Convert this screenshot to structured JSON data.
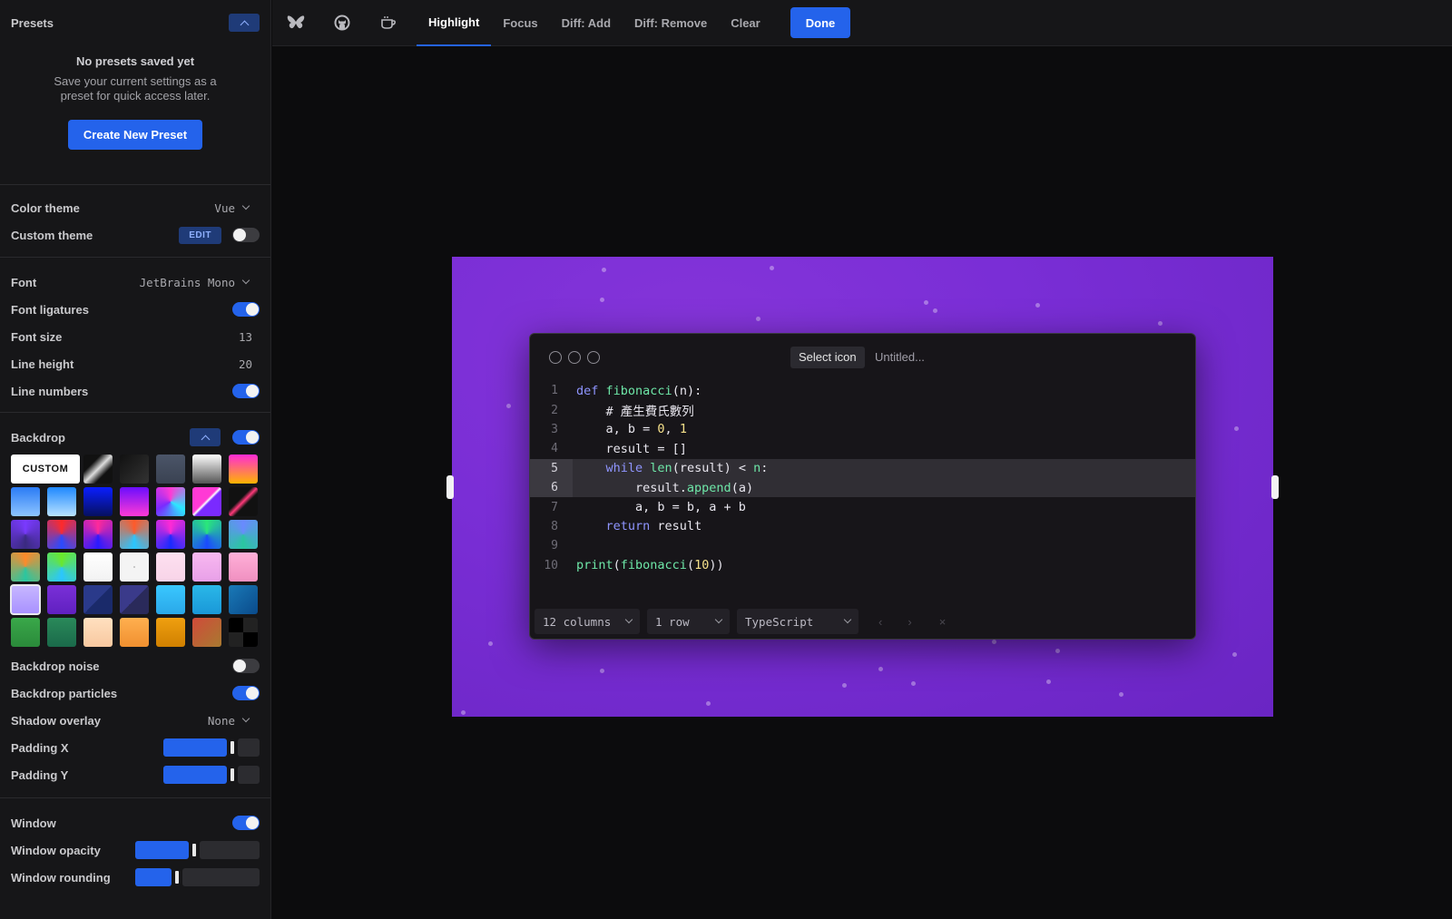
{
  "presets": {
    "title": "Presets",
    "empty_title": "No presets saved yet",
    "empty_desc": "Save your current settings as a preset for quick access later.",
    "create_label": "Create New Preset"
  },
  "theme": {
    "color_theme_label": "Color theme",
    "color_theme_value": "Vue",
    "custom_theme_label": "Custom theme",
    "edit_label": "EDIT",
    "custom_theme_on": false
  },
  "font": {
    "font_label": "Font",
    "font_value": "JetBrains Mono",
    "ligatures_label": "Font ligatures",
    "size_label": "Font size",
    "size_value": "13",
    "line_height_label": "Line height",
    "line_height_value": "20",
    "line_numbers_label": "Line numbers"
  },
  "backdrop": {
    "label": "Backdrop",
    "custom_label": "CUSTOM",
    "swatches": [
      "linear-gradient(135deg,#111 30%,#ddd 50%,#111 70%)",
      "linear-gradient(135deg,#111,#333)",
      "linear-gradient(180deg,#4b5568,#3a4252)",
      "linear-gradient(180deg,#fff,#555)",
      "linear-gradient(180deg,#ff2bd6,#ffb400)",
      "linear-gradient(180deg,#2a7bf5,#8ec5ff)",
      "linear-gradient(180deg,#1e88ff,#b8e2ff)",
      "linear-gradient(180deg,#0a1eff,#061060)",
      "linear-gradient(180deg,#6a0dff,#ff3ad5)",
      "conic-gradient(#ff3ad5,#2ae8ff,#7a2aff,#ff3ad5)",
      "linear-gradient(135deg,#ff3ad5 45%,#fff 50%,#7a2aff 55%)",
      "linear-gradient(135deg,#111 40%,#ff3a7a 50%,#111 60%)",
      "conic-gradient(#7a3aff,#3a2a80,#7a3aff)",
      "conic-gradient(#ff2a2a,#2a4aff,#ff2a2a)",
      "conic-gradient(#ff2a9a,#2a1aff,#ff2a9a)",
      "conic-gradient(#ff5a2a,#2ac6ff,#ff5a2a)",
      "conic-gradient(#ff2ad5,#1a2aff,#ff2ad5)",
      "conic-gradient(#2ae87a,#1a4aff,#2ae87a)",
      "conic-gradient(#6a8aff,#2ac6a0,#6a8aff)",
      "conic-gradient(#ff8a2a,#2ac6a0,#ff8a2a)",
      "conic-gradient(#6ae82a,#2ac6ff,#6ae82a)",
      "linear-gradient(180deg,#fff,#f2f2f2)",
      "radial-gradient(#bbb 1px,#f4f4f4 1px)",
      "linear-gradient(180deg,#fde0f0,#f8d4e8)",
      "linear-gradient(180deg,#f8b8f0,#e8a0e8)",
      "linear-gradient(180deg,#ffb0d8,#f090c0)",
      "linear-gradient(180deg,#c8b8ff,#a890ff)",
      "linear-gradient(180deg,#7a30d8,#6020c0)",
      "linear-gradient(135deg,#2a3a8a 50%,#1a2a6a 50%)",
      "linear-gradient(135deg,#3a3a8a 50%,#2a2a5a 50%)",
      "linear-gradient(180deg,#3ac8ff,#2aa8e8)",
      "linear-gradient(180deg,#2ab8e8,#1a98d8)",
      "linear-gradient(135deg,#1a7ab8,#0a4a8a)",
      "linear-gradient(180deg,#3aa84a,#2a8a3a)",
      "linear-gradient(180deg,#2a8a5a,#1a6a4a)",
      "linear-gradient(180deg,#ffe0c0,#f8c8a0)",
      "linear-gradient(180deg,#ffb050,#f09030)",
      "linear-gradient(180deg,#f0a010,#d08000)",
      "linear-gradient(135deg,#d04a3a,#a87a30)",
      "conic-gradient(#222 25%,#000 25% 50%,#222 50% 75%,#000 75%)"
    ],
    "noise_label": "Backdrop noise",
    "particles_label": "Backdrop particles",
    "shadow_label": "Shadow overlay",
    "shadow_value": "None",
    "padding_x_label": "Padding X",
    "padding_x": 0.75,
    "padding_y_label": "Padding Y",
    "padding_y": 0.75
  },
  "window": {
    "label": "Window",
    "opacity_label": "Window opacity",
    "opacity": 0.47,
    "rounding_label": "Window rounding",
    "rounding": 0.32
  },
  "toolbar": {
    "tabs": [
      "Highlight",
      "Focus",
      "Diff: Add",
      "Diff: Remove",
      "Clear"
    ],
    "done_label": "Done"
  },
  "editor": {
    "select_icon_label": "Select icon",
    "title_placeholder": "Untitled...",
    "lines": [
      {
        "n": "1",
        "text": "def fibonacci(n):"
      },
      {
        "n": "2",
        "text": "    # 產生費氏數列"
      },
      {
        "n": "3",
        "text": "    a, b = 0, 1"
      },
      {
        "n": "4",
        "text": "    result = []"
      },
      {
        "n": "5",
        "text": "    while len(result) < n:"
      },
      {
        "n": "6",
        "text": "        result.append(a)"
      },
      {
        "n": "7",
        "text": "        a, b = b, a + b"
      },
      {
        "n": "8",
        "text": "    return result"
      },
      {
        "n": "9",
        "text": ""
      },
      {
        "n": "10",
        "text": "print(fibonacci(10))"
      }
    ],
    "columns_value": "12 columns",
    "rows_value": "1 row",
    "language_value": "TypeScript",
    "prev_glyph": "‹",
    "next_glyph": "›",
    "close_glyph": "×"
  },
  "colors": {
    "accent": "#2463eb",
    "backdrop": "#7a2ed6",
    "code_keyword": "#8f95ff",
    "code_function": "#6ee7a8",
    "code_number": "#f5e08a",
    "code_comment": "#e8e6ee"
  }
}
